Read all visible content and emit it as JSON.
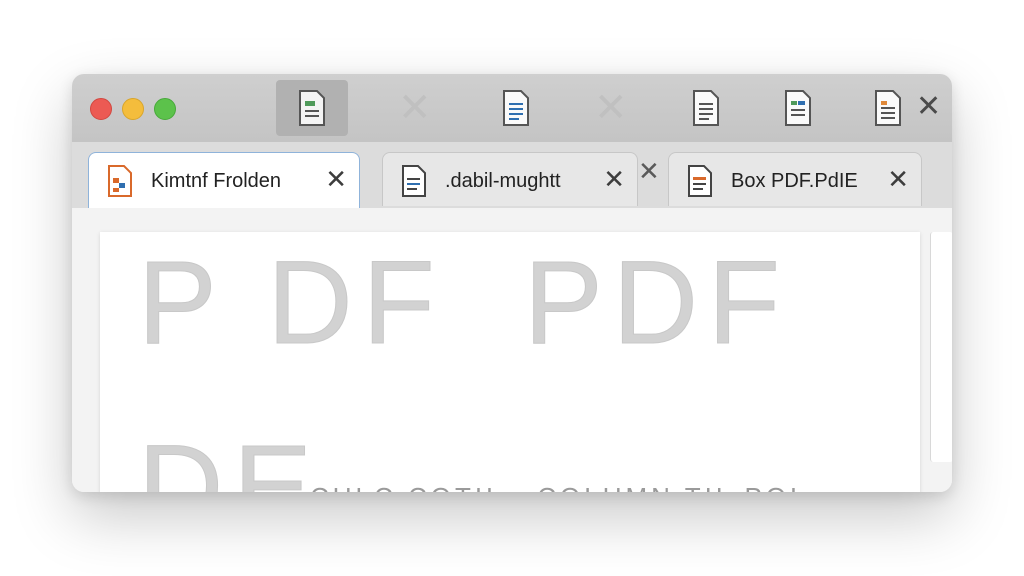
{
  "window": {
    "toolbar": {
      "buttons": [
        "document-icon",
        "document-icon",
        "document-icon",
        "document-icon",
        "document-icon"
      ],
      "close_label": "✕"
    },
    "tabs": [
      {
        "label": "Kimtnf Frolden",
        "close": "✕",
        "icon": "pdf-file-icon",
        "active": true
      },
      {
        "label": ".dabil-mughtt",
        "close": "✕",
        "icon": "text-file-icon",
        "active": false
      },
      {
        "label": "Box PDF.PdIE",
        "close": "✕",
        "icon": "pdf-file-icon",
        "active": false
      }
    ],
    "tab_separator_close": "✕",
    "content": {
      "heading_row": [
        "P DF",
        "PDF"
      ],
      "second_line": "DE",
      "faint_line": "CULC COTIL . COLUMN TIL POL"
    }
  },
  "colors": {
    "close": "#ec5a53",
    "minimize": "#f4bd3c",
    "zoom": "#5cc24b",
    "active_tab_border": "#8fb3da"
  }
}
